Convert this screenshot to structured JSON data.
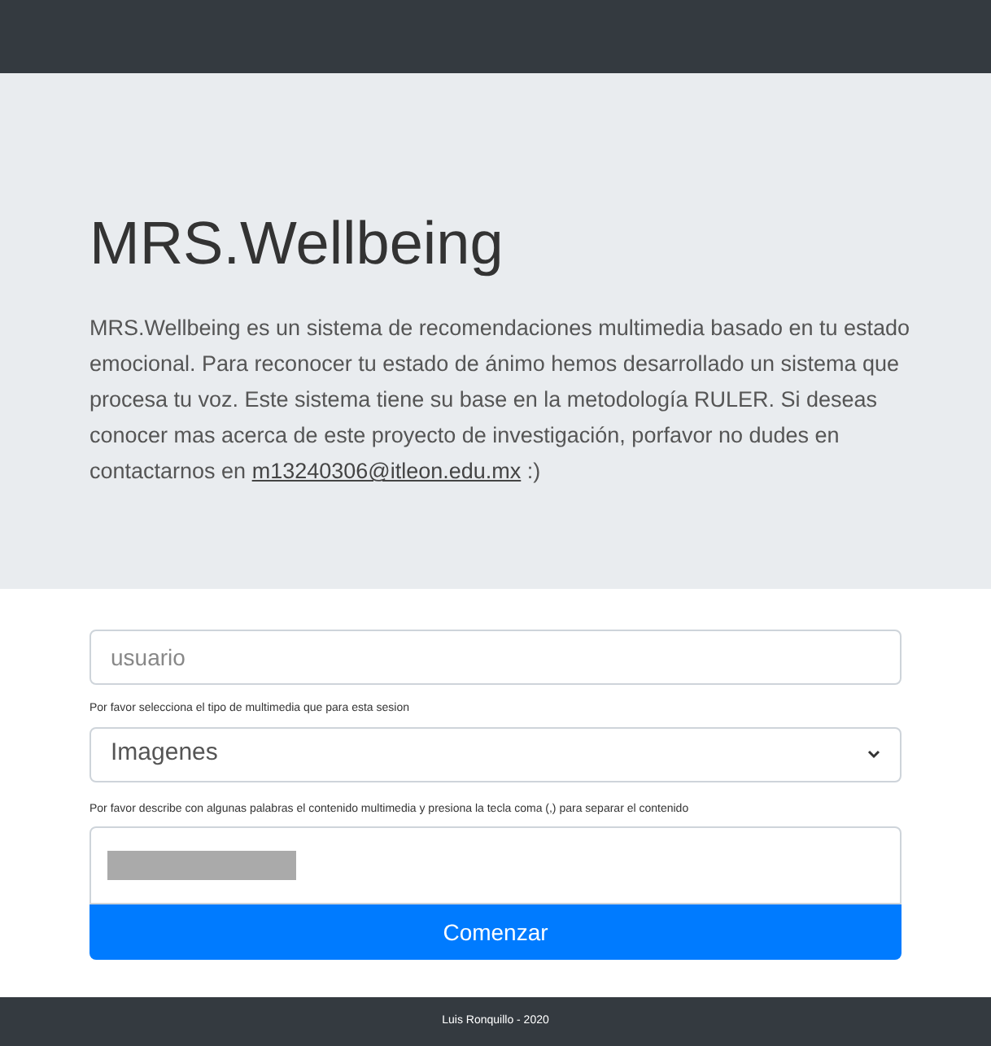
{
  "hero": {
    "title": "MRS.Wellbeing",
    "description": "MRS.Wellbeing es un sistema de recomendaciones multimedia basado en tu estado emocional. Para reconocer tu estado de ánimo hemos desarrollado un sistema que procesa tu voz. Este sistema tiene su base en la metodología RULER. Si deseas conocer mas acerca de este proyecto de investigación, porfavor no dudes en contactarnos en",
    "email": "m13240306@itleon.edu.mx",
    "after": ":)"
  },
  "form": {
    "user_field": {
      "placeholder": "usuario"
    },
    "media_label": "Por favor selecciona el tipo de multimedia que para esta sesion",
    "media_select": {
      "value": "Imagenes"
    },
    "tags_label": "Por favor describe con algunas palabras el contenido multimedia y presiona la tecla coma (,) para separar el contenido",
    "submit": "Comenzar"
  },
  "footer": "Luis Ronquillo - 2020"
}
